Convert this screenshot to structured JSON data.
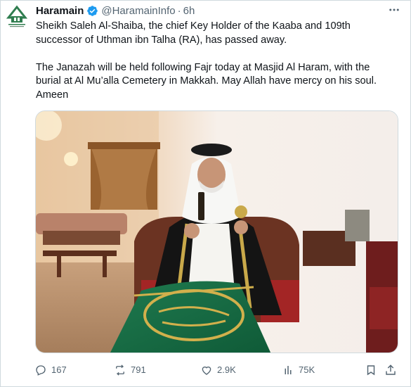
{
  "author": {
    "name": "Haramain",
    "handle": "@HaramainInfo",
    "separator": "·",
    "time": "6h",
    "avatar_icon": "haramain-logo",
    "verified_icon": "verified-badge-icon"
  },
  "tweet": {
    "text": "Sheikh Saleh Al-Shaiba, the chief Key Holder of the Kaaba and 109th\nsuccessor of Uthman ibn Talha (RA), has passed away.\n\nThe Janazah will be held following Fajr today at Masjid Al Haram, with the\nburial at Al Mu’alla Cemetery in Makkah. May Allah have mercy on his soul.\nAmeen"
  },
  "actions": {
    "replies": "167",
    "reposts": "791",
    "likes": "2.9K",
    "views": "75K"
  },
  "colors": {
    "text": "#0f1419",
    "secondary": "#536471",
    "verified": "#1d9bf0",
    "logo_green": "#2f7d4f",
    "border": "#cfd9de"
  }
}
